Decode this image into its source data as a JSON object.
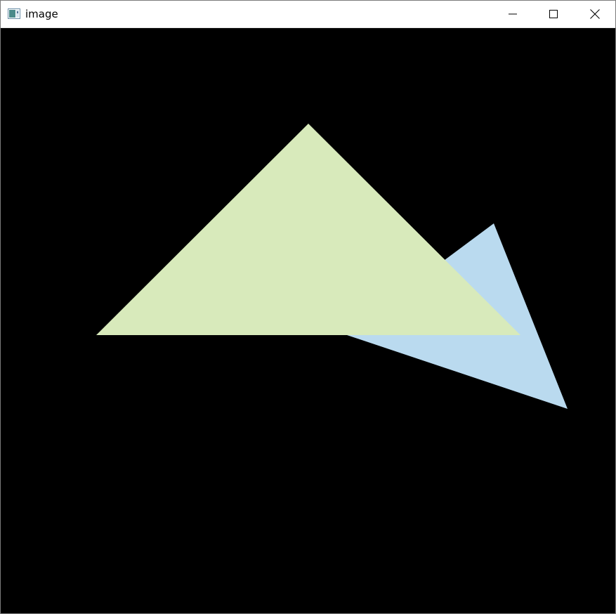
{
  "window": {
    "title": "image",
    "background_color": "#000000"
  },
  "icons": {
    "app": "image-window-icon",
    "minimize": "minimize-icon",
    "maximize": "maximize-icon",
    "close": "close-icon"
  },
  "shapes": {
    "triangle_back": {
      "fill": "#badaef"
    },
    "triangle_front": {
      "fill": "#d8eabb"
    }
  }
}
